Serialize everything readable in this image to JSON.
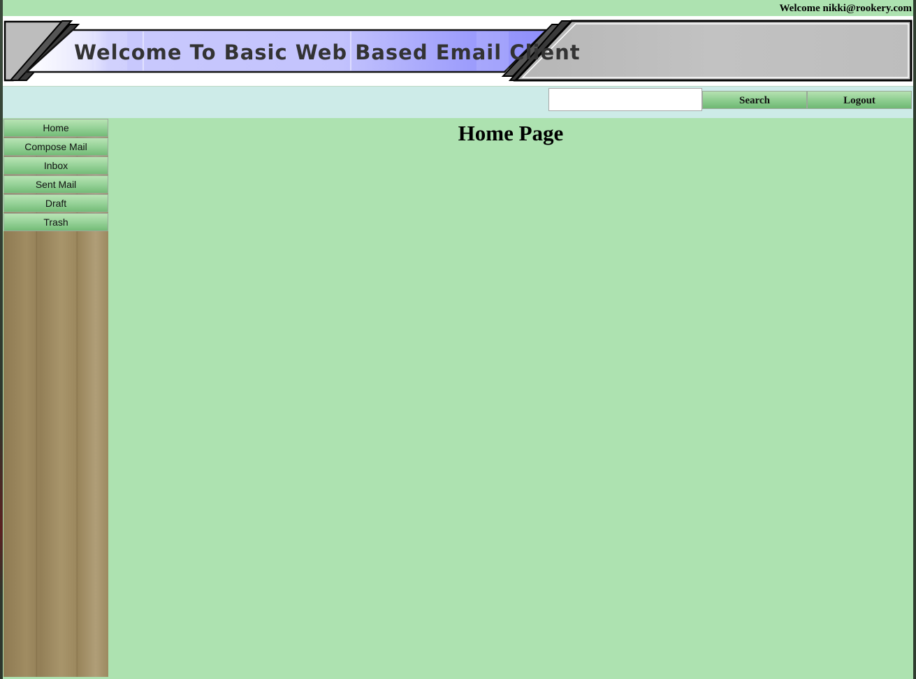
{
  "header": {
    "welcome_text": "Welcome nikki@rookery.com",
    "banner_title": "Welcome To Basic Web Based Email Client"
  },
  "search": {
    "input_value": "",
    "placeholder": "",
    "search_label": "Search",
    "logout_label": "Logout"
  },
  "sidebar": {
    "items": [
      {
        "label": "Home"
      },
      {
        "label": "Compose Mail"
      },
      {
        "label": "Inbox"
      },
      {
        "label": "Sent Mail"
      },
      {
        "label": "Draft"
      },
      {
        "label": "Trash"
      }
    ]
  },
  "main": {
    "title": "Home Page"
  },
  "colors": {
    "page_background": "#ade2b0",
    "search_bar_background": "#cdebe8",
    "button_green": "#8fce91",
    "banner_blue": "#9d9dfc",
    "banner_gray": "#c0c0c0"
  }
}
